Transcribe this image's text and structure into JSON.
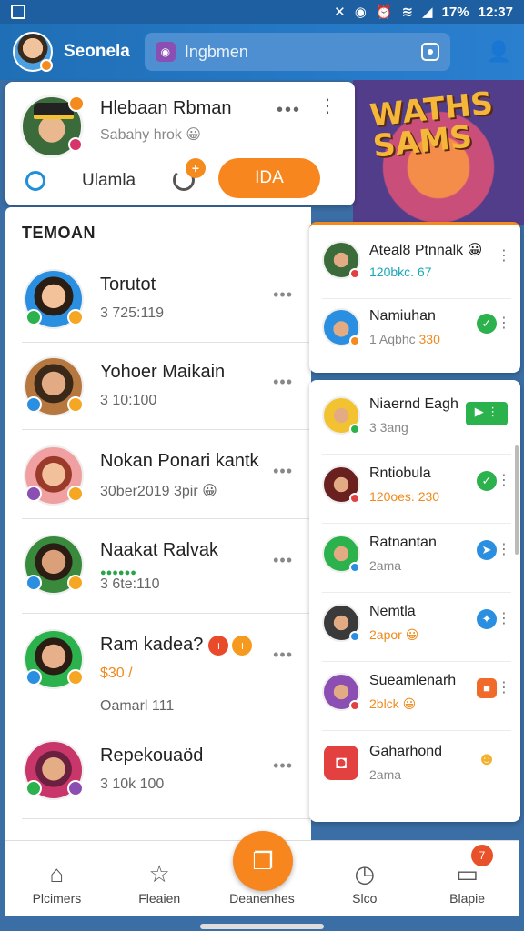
{
  "status_bar": {
    "battery": "17%",
    "time": "12:37"
  },
  "header": {
    "app_name": "Seonela",
    "search_placeholder": "Ingbmen"
  },
  "game_art": {
    "title": "WATHS SAMS"
  },
  "profile": {
    "name": "Hlebaan Rbman",
    "status": "Sabahy hrok 😀",
    "sub_label": "Ulamla",
    "badge": "+",
    "cta_label": "IDA"
  },
  "friends": {
    "section_title": "TEMOAN",
    "items": [
      {
        "name": "Torutot",
        "sub": "3 725:119",
        "b1": "#2bb24c",
        "bg": "#2a8fe0"
      },
      {
        "name": "Yohoer Maikain",
        "sub": "3 10:100",
        "b1": "#2a8fe0",
        "bg": "#b7783f"
      },
      {
        "name": "Nokan Ponari kantk",
        "sub": "30ber2019 3pir 😀",
        "b1": "#8b4fb3",
        "bg": "#f0a0a0"
      },
      {
        "name": "Naakat Ralvak",
        "extra": "●●●●●●",
        "sub": "3 6te:110",
        "b1": "#2a8fe0",
        "bg": "#3a8a3e"
      },
      {
        "name": "Ram kadea?",
        "sub_orange": "$30 /",
        "sub": "Oamarl 111",
        "b1": "#2a8fe0",
        "bg": "#2bb24c"
      },
      {
        "name": "Repekouaöd",
        "sub": "3 10k 100",
        "b1": "#2bb24c",
        "bg": "#c8366a"
      }
    ]
  },
  "right_card_top": {
    "items": [
      {
        "name": "Ateal8 Ptnnalk 😀",
        "sub": "120bkc. 67",
        "action": "emoji"
      },
      {
        "name": "Namiuhan",
        "sub_prefix": "1 Aqbhc ",
        "sub_hl": "330",
        "action": "check"
      }
    ]
  },
  "right_card_list": {
    "items": [
      {
        "name": "Niaernd Eagh",
        "sub": "3 3ang",
        "action": "pill"
      },
      {
        "name": "Rntiobula",
        "sub": "120oes. 230",
        "action": "check"
      },
      {
        "name": "Ratnantan",
        "sub": "2ama",
        "action": "blue"
      },
      {
        "name": "Nemtla",
        "sub": "2apor 😀",
        "action": "blue"
      },
      {
        "name": "Sueamlenarh",
        "sub": "2blck 😀",
        "action": "orange"
      },
      {
        "name": "Gaharhond",
        "sub": "2ama",
        "action": "yellow"
      }
    ]
  },
  "bottom_nav": {
    "items": [
      {
        "label": "Plcimers",
        "icon": "home-icon"
      },
      {
        "label": "Fleaien",
        "icon": "star-icon"
      },
      {
        "label": "Deanenhes",
        "icon": "chat-icon"
      },
      {
        "label": "Slco",
        "icon": "clock-icon"
      },
      {
        "label": "Blapie",
        "icon": "profile-icon"
      }
    ],
    "badge": "7"
  },
  "colors": {
    "accent": "#f7861f",
    "header": "#1f6fb6",
    "green": "#2bb24c",
    "blue": "#2a8fe0"
  }
}
